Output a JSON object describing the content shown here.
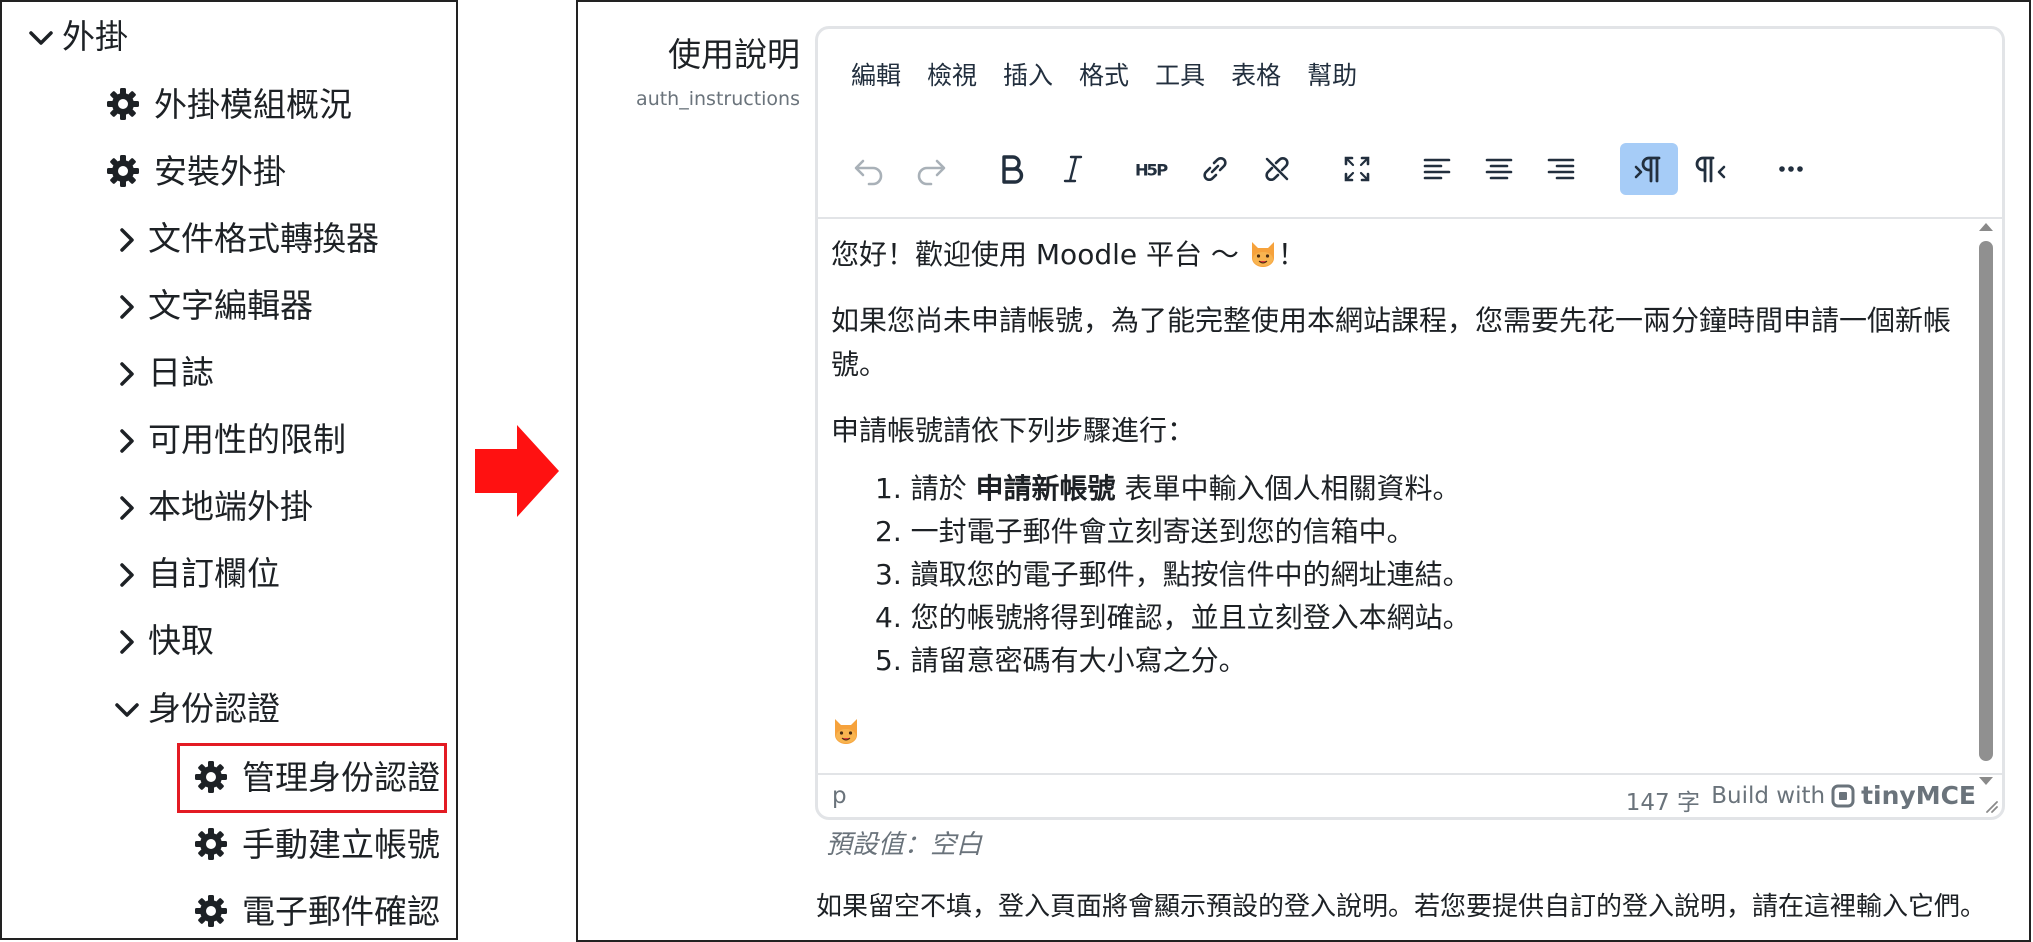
{
  "left_nav": {
    "items": [
      {
        "label": "外掛",
        "type": "expanded"
      },
      {
        "label": "外掛模組概況",
        "type": "setting"
      },
      {
        "label": "安裝外掛",
        "type": "setting"
      },
      {
        "label": "文件格式轉換器",
        "type": "collapsed"
      },
      {
        "label": "文字編輯器",
        "type": "collapsed"
      },
      {
        "label": "日誌",
        "type": "collapsed"
      },
      {
        "label": "可用性的限制",
        "type": "collapsed"
      },
      {
        "label": "本地端外掛",
        "type": "collapsed"
      },
      {
        "label": "自訂欄位",
        "type": "collapsed"
      },
      {
        "label": "快取",
        "type": "collapsed"
      },
      {
        "label": "身份認證",
        "type": "expanded"
      },
      {
        "label": "管理身份認證",
        "type": "setting",
        "highlighted": true
      },
      {
        "label": "手動建立帳號",
        "type": "setting"
      },
      {
        "label": "電子郵件確認",
        "type": "setting"
      }
    ]
  },
  "setting": {
    "title": "使用說明",
    "key": "auth_instructions",
    "default_value": "預設值：空白",
    "help_text": "如果留空不填，登入頁面將會顯示預設的登入說明。若您要提供自訂的登入說明，請在這裡輸入它們。"
  },
  "editor": {
    "menu": [
      "編輯",
      "檢視",
      "插入",
      "格式",
      "工具",
      "表格",
      "幫助"
    ],
    "toolbar": [
      {
        "name": "undo-icon",
        "state": "disabled"
      },
      {
        "name": "redo-icon",
        "state": "disabled"
      },
      {
        "name": "bold-icon",
        "state": "normal"
      },
      {
        "name": "italic-icon",
        "state": "normal"
      },
      {
        "name": "h5p-icon",
        "state": "normal"
      },
      {
        "name": "link-icon",
        "state": "normal"
      },
      {
        "name": "unlink-icon",
        "state": "normal"
      },
      {
        "name": "fullscreen-icon",
        "state": "normal"
      },
      {
        "name": "align-left-icon",
        "state": "normal"
      },
      {
        "name": "align-center-icon",
        "state": "normal"
      },
      {
        "name": "align-right-icon",
        "state": "normal"
      },
      {
        "name": "ltr-icon",
        "state": "active"
      },
      {
        "name": "rtl-icon",
        "state": "normal"
      },
      {
        "name": "more-icon",
        "state": "normal"
      }
    ],
    "content": {
      "greeting_before": "您好！歡迎使用 Moodle 平台 〜 ",
      "greeting_after": "！",
      "intro": "如果您尚未申請帳號，為了能完整使用本網站課程，您需要先花一兩分鐘時間申請一個新帳號。",
      "steps_heading": "申請帳號請依下列步驟進行：",
      "step1_before": "1. 請於 ",
      "step1_bold": "申請新帳號",
      "step1_after": " 表單中輸入個人相關資料。",
      "step2": "2. 一封電子郵件會立刻寄送到您的信箱中。",
      "step3": "3. 讀取您的電子郵件，點按信件中的網址連結。",
      "step4": "4. 您的帳號將得到確認，並且立刻登入本網站。",
      "step5": "5. 請留意密碼有大小寫之分。"
    },
    "status": {
      "path": "p",
      "word_count": "147 字",
      "build_with": "Build with",
      "brand": "tinyMCE"
    }
  },
  "colors": {
    "highlight": "#e31b23",
    "arrow": "#ff1111",
    "active_button": "#a6ccf7"
  }
}
